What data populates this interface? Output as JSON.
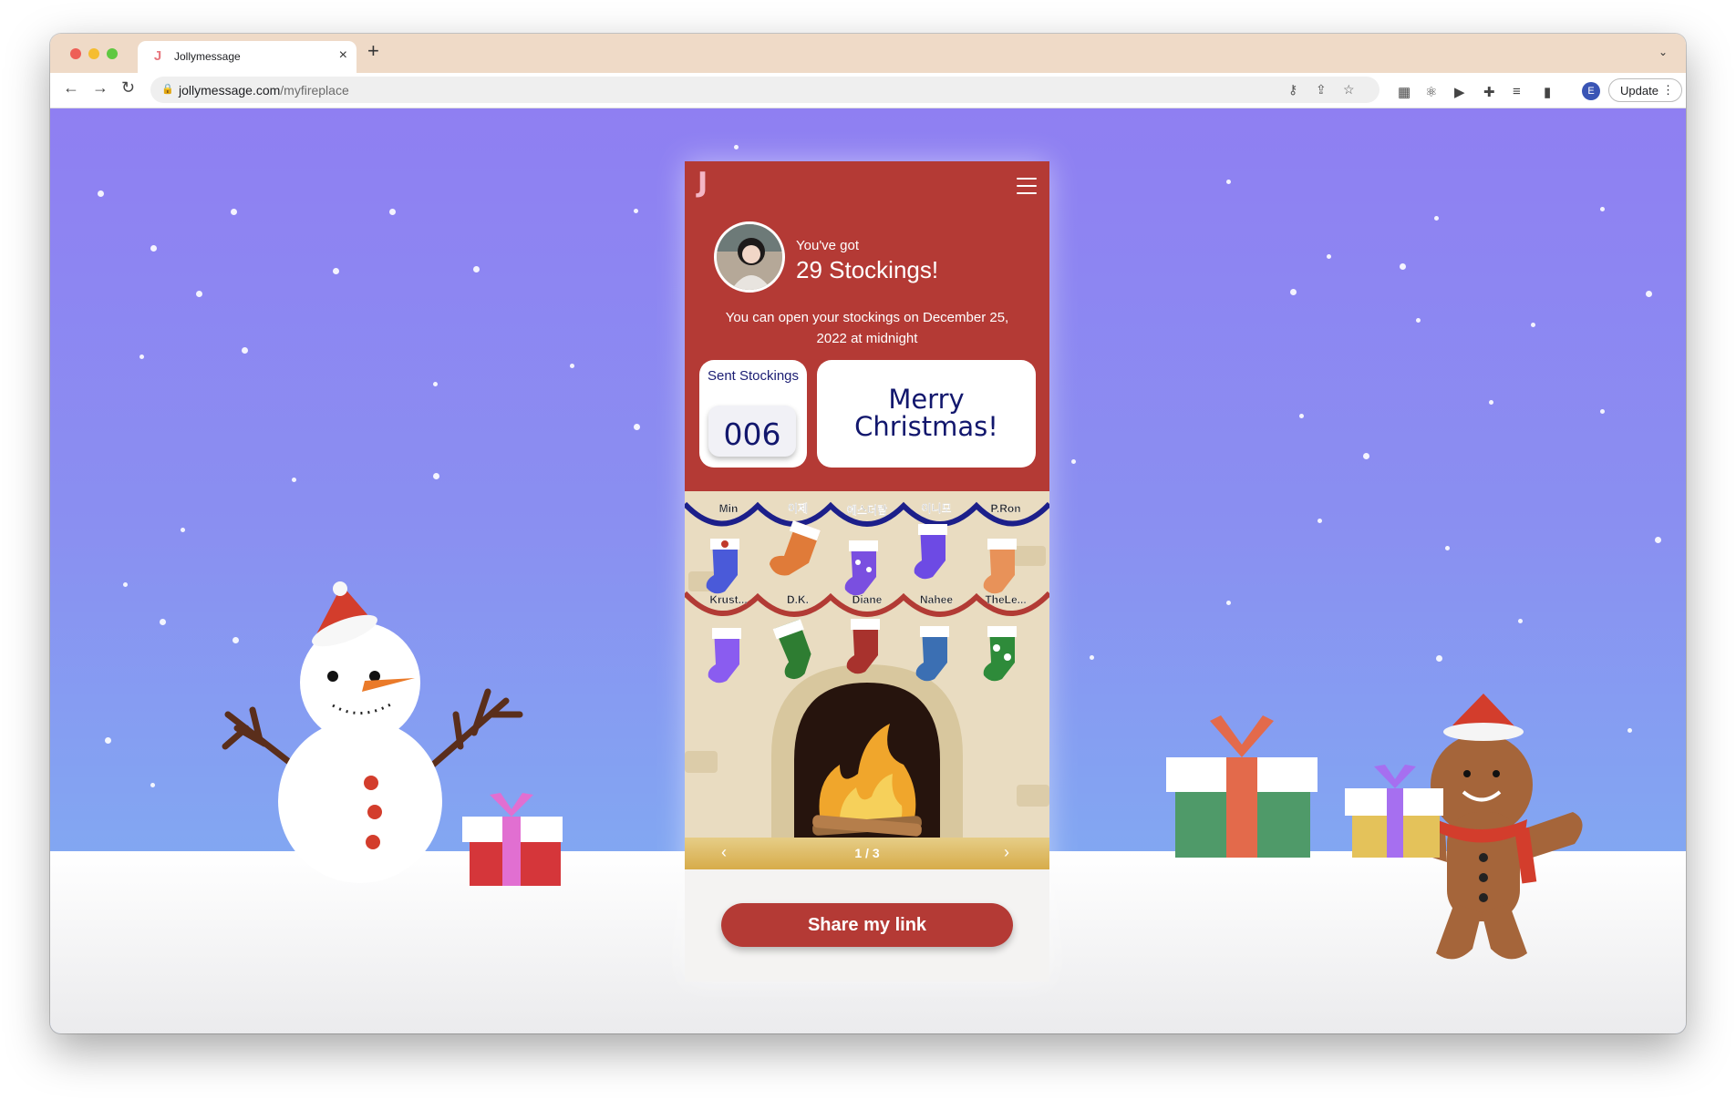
{
  "browser": {
    "tab_title": "Jollymessage",
    "url_domain": "jollymessage.com",
    "url_path": "/myfireplace",
    "update_label": "Update",
    "profile_initial": "E"
  },
  "app": {
    "logo": "J",
    "got_label": "You've got",
    "stockings_count": "29 Stockings!",
    "open_note": "You can open your stockings on December 25, 2022 at midnight",
    "sent_label": "Sent Stockings",
    "sent_count": "006",
    "greeting": "Merry Christmas!",
    "top_names": [
      "Min",
      "이제",
      "에스더람",
      "이니모",
      "P.Ron"
    ],
    "mid_names": [
      "Krust...",
      "D.K.",
      "Diane",
      "Nahee",
      "TheLe..."
    ],
    "pager": "1 / 3",
    "share_label": "Share my link"
  },
  "colors": {
    "header_red": "#b43a35",
    "navy": "#12176d",
    "sky": "#8f7ff2"
  }
}
